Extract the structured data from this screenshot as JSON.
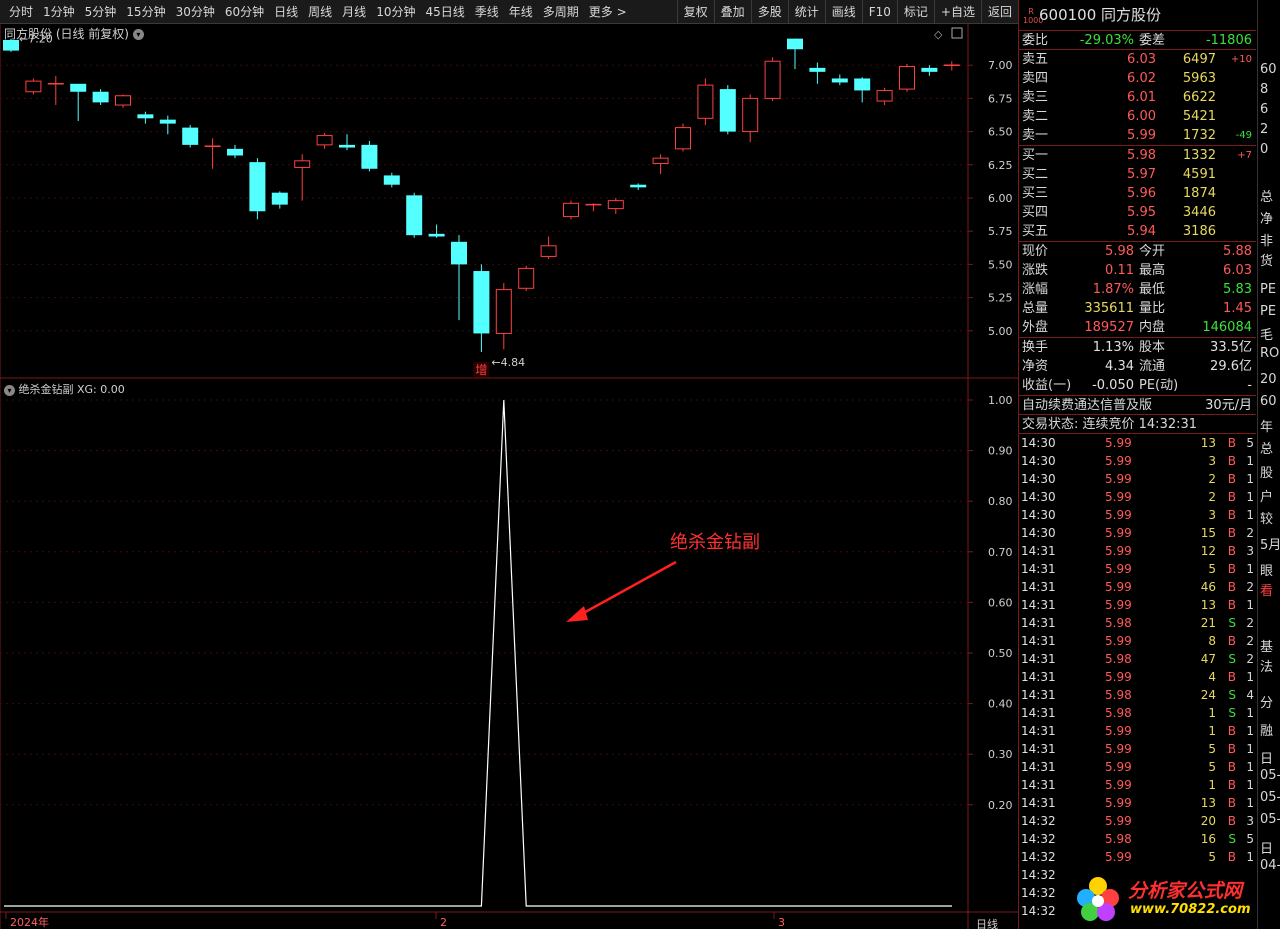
{
  "toolbar": {
    "periods": [
      "分时",
      "1分钟",
      "5分钟",
      "15分钟",
      "30分钟",
      "60分钟",
      "日线",
      "周线",
      "月线",
      "10分钟",
      "45日线",
      "季线",
      "年线",
      "多周期",
      "更多 >"
    ],
    "buttons": [
      "复权",
      "叠加",
      "多股",
      "统计",
      "画线",
      "F10",
      "标记",
      "+自选",
      "返回"
    ]
  },
  "main_chart": {
    "title": "同方股份 (日线 前复权)",
    "y_ticks": [
      "7.00",
      "6.75",
      "6.50",
      "6.25",
      "6.00",
      "5.75",
      "5.50",
      "5.25",
      "5.00"
    ],
    "y_values": [
      7.0,
      6.75,
      6.5,
      6.25,
      6.0,
      5.75,
      5.5,
      5.25,
      5.0
    ],
    "y_range": [
      4.84,
      7.2
    ],
    "high_label": "7.20",
    "low_label": "4.84",
    "marker_label": "增",
    "colors": {
      "up": "#ff4040",
      "down": "#54ffff",
      "axis": "#7a1a1a"
    },
    "candles": [
      {
        "o": 7.19,
        "c": 7.11,
        "h": 7.2,
        "l": 7.1
      },
      {
        "o": 6.8,
        "c": 6.88,
        "h": 6.9,
        "l": 6.78
      },
      {
        "o": 6.85,
        "c": 6.86,
        "h": 6.92,
        "l": 6.7
      },
      {
        "o": 6.86,
        "c": 6.8,
        "h": 6.82,
        "l": 6.58
      },
      {
        "o": 6.8,
        "c": 6.72,
        "h": 6.82,
        "l": 6.7
      },
      {
        "o": 6.7,
        "c": 6.77,
        "h": 6.78,
        "l": 6.68
      },
      {
        "o": 6.63,
        "c": 6.6,
        "h": 6.65,
        "l": 6.56
      },
      {
        "o": 6.59,
        "c": 6.56,
        "h": 6.62,
        "l": 6.48
      },
      {
        "o": 6.53,
        "c": 6.4,
        "h": 6.55,
        "l": 6.38
      },
      {
        "o": 6.39,
        "c": 6.39,
        "h": 6.45,
        "l": 6.22
      },
      {
        "o": 6.37,
        "c": 6.32,
        "h": 6.4,
        "l": 6.3
      },
      {
        "o": 6.27,
        "c": 5.9,
        "h": 6.3,
        "l": 5.84
      },
      {
        "o": 6.04,
        "c": 5.95,
        "h": 6.05,
        "l": 5.92
      },
      {
        "o": 6.23,
        "c": 6.28,
        "h": 6.33,
        "l": 5.98
      },
      {
        "o": 6.4,
        "c": 6.47,
        "h": 6.49,
        "l": 6.37
      },
      {
        "o": 6.4,
        "c": 6.38,
        "h": 6.48,
        "l": 6.36
      },
      {
        "o": 6.4,
        "c": 6.22,
        "h": 6.43,
        "l": 6.2
      },
      {
        "o": 6.17,
        "c": 6.1,
        "h": 6.19,
        "l": 6.08
      },
      {
        "o": 6.02,
        "c": 5.72,
        "h": 6.04,
        "l": 5.7
      },
      {
        "o": 5.73,
        "c": 5.71,
        "h": 5.8,
        "l": 5.7
      },
      {
        "o": 5.67,
        "c": 5.5,
        "h": 5.72,
        "l": 5.08
      },
      {
        "o": 5.45,
        "c": 4.98,
        "h": 5.5,
        "l": 4.84
      },
      {
        "o": 4.98,
        "c": 5.31,
        "h": 5.36,
        "l": 4.86
      },
      {
        "o": 5.32,
        "c": 5.47,
        "h": 5.49,
        "l": 5.3
      },
      {
        "o": 5.56,
        "c": 5.64,
        "h": 5.71,
        "l": 5.54
      },
      {
        "o": 5.86,
        "c": 5.96,
        "h": 5.98,
        "l": 5.84
      },
      {
        "o": 5.95,
        "c": 5.95,
        "h": 5.96,
        "l": 5.9
      },
      {
        "o": 5.92,
        "c": 5.98,
        "h": 6.0,
        "l": 5.88
      },
      {
        "o": 6.1,
        "c": 6.08,
        "h": 6.11,
        "l": 6.06
      },
      {
        "o": 6.26,
        "c": 6.3,
        "h": 6.33,
        "l": 6.18
      },
      {
        "o": 6.37,
        "c": 6.53,
        "h": 6.56,
        "l": 6.35
      },
      {
        "o": 6.6,
        "c": 6.85,
        "h": 6.9,
        "l": 6.55
      },
      {
        "o": 6.82,
        "c": 6.5,
        "h": 6.85,
        "l": 6.48
      },
      {
        "o": 6.5,
        "c": 6.75,
        "h": 6.78,
        "l": 6.42
      },
      {
        "o": 6.75,
        "c": 7.03,
        "h": 7.06,
        "l": 6.73
      },
      {
        "o": 7.2,
        "c": 7.12,
        "h": 7.2,
        "l": 6.97
      },
      {
        "o": 6.98,
        "c": 6.95,
        "h": 7.02,
        "l": 6.86
      },
      {
        "o": 6.9,
        "c": 6.87,
        "h": 6.93,
        "l": 6.85
      },
      {
        "o": 6.9,
        "c": 6.81,
        "h": 6.91,
        "l": 6.72
      },
      {
        "o": 6.73,
        "c": 6.81,
        "h": 6.83,
        "l": 6.7
      },
      {
        "o": 6.82,
        "c": 6.99,
        "h": 7.01,
        "l": 6.8
      },
      {
        "o": 6.98,
        "c": 6.95,
        "h": 7.0,
        "l": 6.92
      },
      {
        "o": 7.0,
        "c": 7.0,
        "h": 7.03,
        "l": 6.96
      }
    ]
  },
  "sub_chart": {
    "title": "绝杀金钻副",
    "value_label": "XG: 0.00",
    "y_ticks": [
      "1.00",
      "0.90",
      "0.80",
      "0.70",
      "0.60",
      "0.50",
      "0.40",
      "0.30",
      "0.20"
    ],
    "y_values": [
      1.0,
      0.9,
      0.8,
      0.7,
      0.6,
      0.5,
      0.4,
      0.3,
      0.2
    ],
    "annotation": "绝杀金钻副",
    "values": [
      0,
      0,
      0,
      0,
      0,
      0,
      0,
      0,
      0,
      0,
      0,
      0,
      0,
      0,
      0,
      0,
      0,
      0,
      0,
      0,
      0,
      0,
      1,
      0,
      0,
      0,
      0,
      0,
      0,
      0,
      0,
      0,
      0,
      0,
      0,
      0,
      0,
      0,
      0,
      0,
      0,
      0,
      0
    ]
  },
  "x_axis": {
    "labels": [
      "2024年",
      "2",
      "3"
    ],
    "period": "日线"
  },
  "quote": {
    "badge_top": "R",
    "badge_bottom": "1000",
    "code": "600100",
    "name": "同方股份",
    "weibi_label": "委比",
    "weibi_value": "-29.03%",
    "weicha_label": "委差",
    "weicha_value": "-11806",
    "asks": [
      {
        "label": "卖五",
        "price": "6.03",
        "vol": "6497",
        "chg": "+10"
      },
      {
        "label": "卖四",
        "price": "6.02",
        "vol": "5963",
        "chg": ""
      },
      {
        "label": "卖三",
        "price": "6.01",
        "vol": "6622",
        "chg": ""
      },
      {
        "label": "卖二",
        "price": "6.00",
        "vol": "5421",
        "chg": ""
      },
      {
        "label": "卖一",
        "price": "5.99",
        "vol": "1732",
        "chg": "-49"
      }
    ],
    "bids": [
      {
        "label": "买一",
        "price": "5.98",
        "vol": "1332",
        "chg": "+7"
      },
      {
        "label": "买二",
        "price": "5.97",
        "vol": "4591",
        "chg": ""
      },
      {
        "label": "买三",
        "price": "5.96",
        "vol": "1874",
        "chg": ""
      },
      {
        "label": "买四",
        "price": "5.95",
        "vol": "3446",
        "chg": ""
      },
      {
        "label": "买五",
        "price": "5.94",
        "vol": "3186",
        "chg": ""
      }
    ],
    "stats": [
      {
        "l1": "现价",
        "v1": "5.98",
        "l2": "今开",
        "v2": "5.88",
        "c1": "red",
        "c2": "red"
      },
      {
        "l1": "涨跌",
        "v1": "0.11",
        "l2": "最高",
        "v2": "6.03",
        "c1": "red",
        "c2": "red"
      },
      {
        "l1": "涨幅",
        "v1": "1.87%",
        "l2": "最低",
        "v2": "5.83",
        "c1": "red",
        "c2": "green"
      },
      {
        "l1": "总量",
        "v1": "335611",
        "l2": "量比",
        "v2": "1.45",
        "c1": "yellow",
        "c2": "red"
      },
      {
        "l1": "外盘",
        "v1": "189527",
        "l2": "内盘",
        "v2": "146084",
        "c1": "red",
        "c2": "green"
      }
    ],
    "stats2": [
      {
        "l1": "换手",
        "v1": "1.13%",
        "l2": "股本",
        "v2": "33.5亿",
        "c1": "white",
        "c2": "white"
      },
      {
        "l1": "净资",
        "v1": "4.34",
        "l2": "流通",
        "v2": "29.6亿",
        "c1": "white",
        "c2": "white"
      },
      {
        "l1": "收益(一)",
        "v1": "-0.050",
        "l2": "PE(动)",
        "v2": "-",
        "c1": "white",
        "c2": "white"
      }
    ],
    "promo": "自动续费通达信普及版",
    "promo_price": "30元/月",
    "trade_status": "交易状态: 连续竞价 14:32:31"
  },
  "ticks": [
    {
      "t": "14:30",
      "p": "5.99",
      "v": "13",
      "bs": "B",
      "n": "5"
    },
    {
      "t": "14:30",
      "p": "5.99",
      "v": "3",
      "bs": "B",
      "n": "1"
    },
    {
      "t": "14:30",
      "p": "5.99",
      "v": "2",
      "bs": "B",
      "n": "1"
    },
    {
      "t": "14:30",
      "p": "5.99",
      "v": "2",
      "bs": "B",
      "n": "1"
    },
    {
      "t": "14:30",
      "p": "5.99",
      "v": "3",
      "bs": "B",
      "n": "1"
    },
    {
      "t": "14:30",
      "p": "5.99",
      "v": "15",
      "bs": "B",
      "n": "2"
    },
    {
      "t": "14:31",
      "p": "5.99",
      "v": "12",
      "bs": "B",
      "n": "3"
    },
    {
      "t": "14:31",
      "p": "5.99",
      "v": "5",
      "bs": "B",
      "n": "1"
    },
    {
      "t": "14:31",
      "p": "5.99",
      "v": "46",
      "bs": "B",
      "n": "2"
    },
    {
      "t": "14:31",
      "p": "5.99",
      "v": "13",
      "bs": "B",
      "n": "1"
    },
    {
      "t": "14:31",
      "p": "5.98",
      "v": "21",
      "bs": "S",
      "n": "2"
    },
    {
      "t": "14:31",
      "p": "5.99",
      "v": "8",
      "bs": "B",
      "n": "2"
    },
    {
      "t": "14:31",
      "p": "5.98",
      "v": "47",
      "bs": "S",
      "n": "2"
    },
    {
      "t": "14:31",
      "p": "5.99",
      "v": "4",
      "bs": "B",
      "n": "1"
    },
    {
      "t": "14:31",
      "p": "5.98",
      "v": "24",
      "bs": "S",
      "n": "4"
    },
    {
      "t": "14:31",
      "p": "5.98",
      "v": "1",
      "bs": "S",
      "n": "1"
    },
    {
      "t": "14:31",
      "p": "5.99",
      "v": "1",
      "bs": "B",
      "n": "1"
    },
    {
      "t": "14:31",
      "p": "5.99",
      "v": "5",
      "bs": "B",
      "n": "1"
    },
    {
      "t": "14:31",
      "p": "5.99",
      "v": "5",
      "bs": "B",
      "n": "1"
    },
    {
      "t": "14:31",
      "p": "5.99",
      "v": "1",
      "bs": "B",
      "n": "1"
    },
    {
      "t": "14:31",
      "p": "5.99",
      "v": "13",
      "bs": "B",
      "n": "1"
    },
    {
      "t": "14:32",
      "p": "5.99",
      "v": "20",
      "bs": "B",
      "n": "3"
    },
    {
      "t": "14:32",
      "p": "5.98",
      "v": "16",
      "bs": "S",
      "n": "5"
    },
    {
      "t": "14:32",
      "p": "5.99",
      "v": "5",
      "bs": "B",
      "n": "1"
    },
    {
      "t": "14:32",
      "p": "",
      "v": "",
      "bs": "",
      "n": ""
    },
    {
      "t": "14:32",
      "p": "",
      "v": "",
      "bs": "",
      "n": ""
    },
    {
      "t": "14:32",
      "p": "",
      "v": "",
      "bs": "",
      "n": ""
    }
  ],
  "far_right": [
    "60",
    "8",
    "6",
    "2",
    "0",
    "总",
    "净",
    "非",
    "货",
    "PE",
    "PE",
    "毛",
    "RO",
    "20",
    "60",
    "年",
    "总",
    "股",
    "户",
    "较",
    "5月",
    "眼",
    "看",
    "基",
    "法",
    "分",
    "融",
    "日",
    "05-",
    "05-",
    "05-",
    "日",
    "04-"
  ],
  "watermark": {
    "text": "分析家公式网",
    "url": "www.70822.com"
  }
}
